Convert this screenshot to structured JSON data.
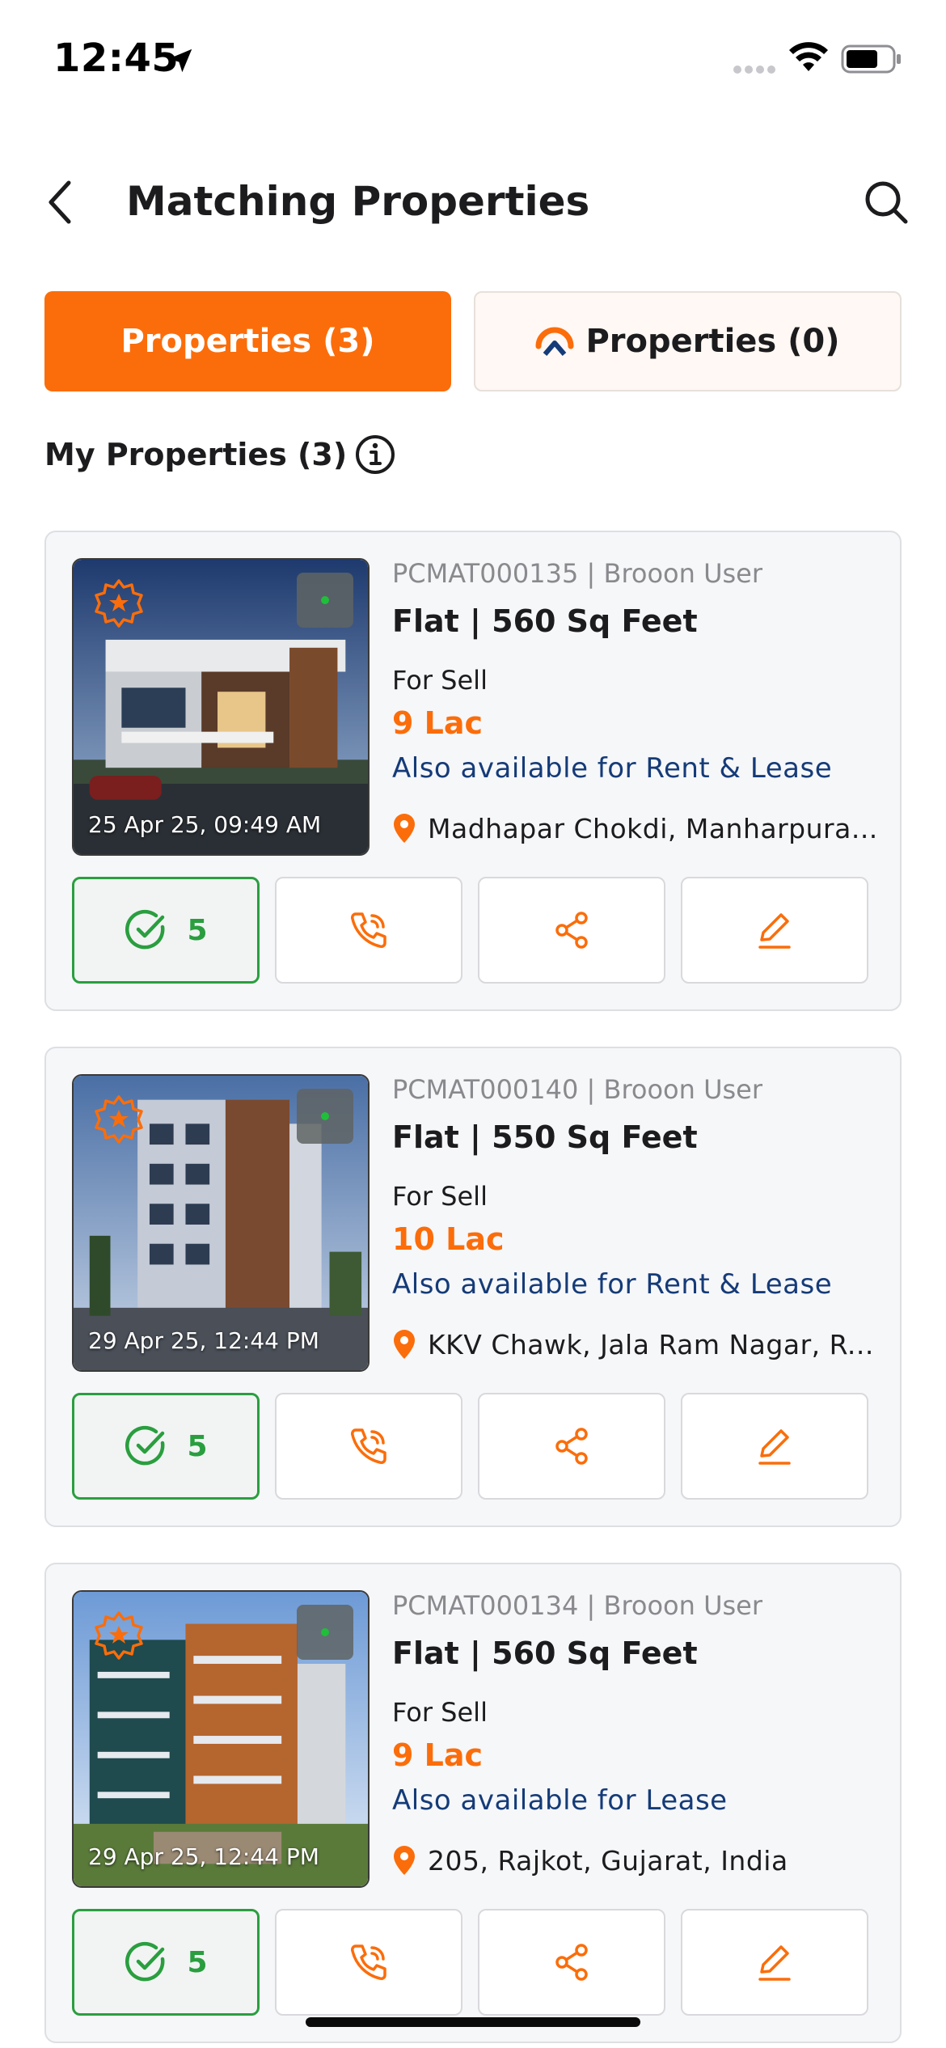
{
  "status_bar": {
    "time": "12:45"
  },
  "header": {
    "title": "Matching Properties"
  },
  "tabs": [
    {
      "label": "Properties (3)",
      "active": true
    },
    {
      "label": "Properties (0)",
      "active": false
    }
  ],
  "section": {
    "title": "My Properties (3)"
  },
  "colors": {
    "accent": "#fb6d0a",
    "availability": "#153b78",
    "match_green": "#2a9e3f",
    "online_dot": "#1fbf3a"
  },
  "properties": [
    {
      "meta": "PCMAT000135 | Brooon User",
      "title": "Flat | 560 Sq Feet",
      "purpose": "For Sell",
      "price": "9 Lac",
      "availability": "Also available for Rent & Lease",
      "location": "Madhapar Chokdi, Manharpura...",
      "date": "25 Apr 25, 09:49 AM",
      "match_count": "5",
      "image_icon": "modern-villa-photo"
    },
    {
      "meta": "PCMAT000140 | Brooon User",
      "title": "Flat | 550 Sq Feet",
      "purpose": "For Sell",
      "price": "10 Lac",
      "availability": "Also available for Rent & Lease",
      "location": "KKV Chawk, Jala Ram Nagar, R...",
      "date": "29 Apr 25, 12:44 PM",
      "match_count": "5",
      "image_icon": "apartment-tower-photo"
    },
    {
      "meta": "PCMAT000134 | Brooon User",
      "title": "Flat | 560 Sq Feet",
      "purpose": "For Sell",
      "price": "9 Lac",
      "availability": "Also available for Lease",
      "location": "205,  Rajkot, Gujarat, India",
      "date": "29 Apr 25, 12:44 PM",
      "match_count": "5",
      "image_icon": "apartment-block-photo"
    }
  ]
}
